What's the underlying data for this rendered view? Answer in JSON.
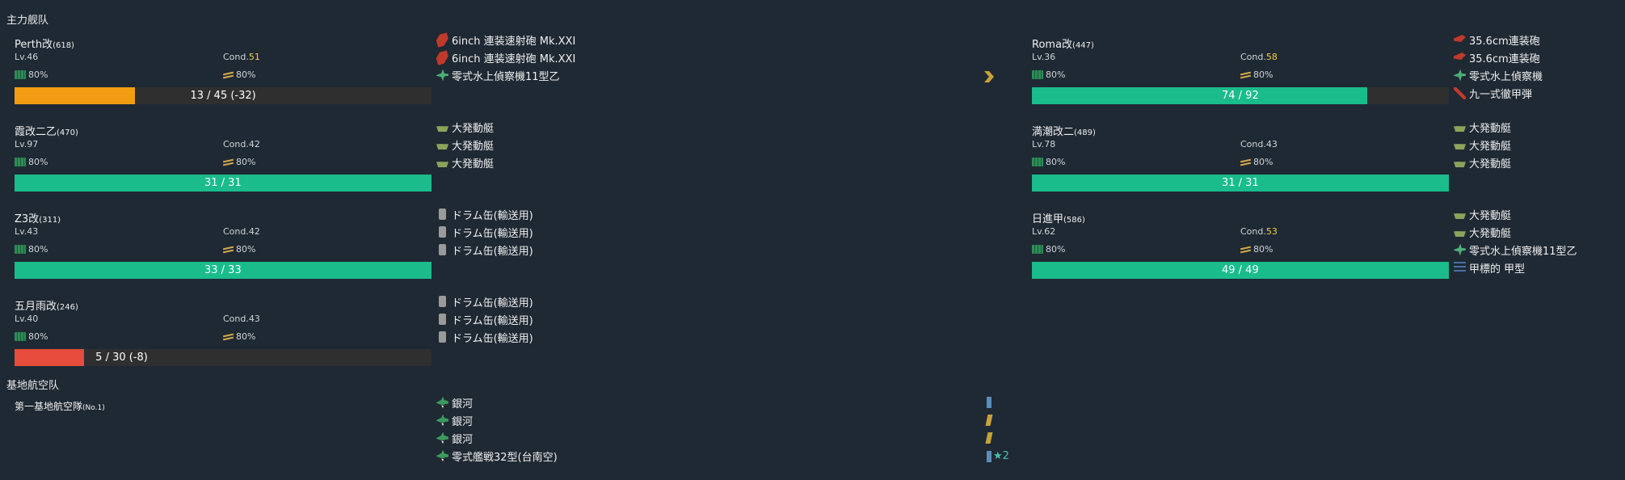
{
  "fleet": {
    "title": "主力舰队",
    "ships": [
      {
        "name": "Perth改",
        "id": "(618)",
        "lv": "Lv.46",
        "cond_label": "Cond.",
        "cond_value": "51",
        "cond_hi": true,
        "fuel": "80%",
        "ammo": "80%",
        "hp_text": "13 / 45 (-32)",
        "hp_frac": 0.289,
        "hp_color": "#f39c12",
        "equip": [
          {
            "icon": "ic-gun",
            "name": "6inch 連装速射砲 Mk.XXI"
          },
          {
            "icon": "ic-gun",
            "name": "6inch 連装速射砲 Mk.XXI"
          },
          {
            "icon": "ic-plane",
            "name": "零式水上偵察機11型乙",
            "prof": "1"
          }
        ]
      },
      {
        "name": "霞改二乙",
        "id": "(470)",
        "lv": "Lv.97",
        "cond_label": "Cond.",
        "cond_value": "42",
        "cond_hi": false,
        "fuel": "80%",
        "ammo": "80%",
        "hp_text": "31 / 31",
        "hp_frac": 1.0,
        "hp_color": "#1abc8c",
        "equip": [
          {
            "icon": "ic-boat",
            "name": "大発動艇"
          },
          {
            "icon": "ic-boat",
            "name": "大発動艇"
          },
          {
            "icon": "ic-boat",
            "name": "大発動艇"
          }
        ]
      },
      {
        "name": "Z3改",
        "id": "(311)",
        "lv": "Lv.43",
        "cond_label": "Cond.",
        "cond_value": "42",
        "cond_hi": false,
        "fuel": "80%",
        "ammo": "80%",
        "hp_text": "33 / 33",
        "hp_frac": 1.0,
        "hp_color": "#1abc8c",
        "equip": [
          {
            "icon": "ic-drum",
            "name": "ドラム缶(輸送用)"
          },
          {
            "icon": "ic-drum",
            "name": "ドラム缶(輸送用)"
          },
          {
            "icon": "ic-drum",
            "name": "ドラム缶(輸送用)"
          }
        ]
      },
      {
        "name": "五月雨改",
        "id": "(246)",
        "lv": "Lv.40",
        "cond_label": "Cond.",
        "cond_value": "43",
        "cond_hi": false,
        "fuel": "80%",
        "ammo": "80%",
        "hp_text": "5 / 30 (-8)",
        "hp_frac": 0.167,
        "hp_color": "#e74c3c",
        "equip": [
          {
            "icon": "ic-drum",
            "name": "ドラム缶(輸送用)"
          },
          {
            "icon": "ic-drum",
            "name": "ドラム缶(輸送用)"
          },
          {
            "icon": "ic-drum",
            "name": "ドラム缶(輸送用)"
          }
        ]
      },
      {
        "name": "Roma改",
        "id": "(447)",
        "lv": "Lv.36",
        "cond_label": "Cond.",
        "cond_value": "58",
        "cond_hi": true,
        "fuel": "80%",
        "ammo": "80%",
        "hp_text": "74 / 92",
        "hp_frac": 0.804,
        "hp_color": "#1abc8c",
        "equip": [
          {
            "icon": "ic-gunl",
            "name": "35.6cm連装砲"
          },
          {
            "icon": "ic-gunl",
            "name": "35.6cm連装砲"
          },
          {
            "icon": "ic-plane",
            "name": "零式水上偵察機",
            "prof": "3"
          },
          {
            "icon": "ic-shell",
            "name": "九一式徹甲弾"
          }
        ]
      },
      {
        "name": "満潮改二",
        "id": "(489)",
        "lv": "Lv.78",
        "cond_label": "Cond.",
        "cond_value": "43",
        "cond_hi": false,
        "fuel": "80%",
        "ammo": "80%",
        "hp_text": "31 / 31",
        "hp_frac": 1.0,
        "hp_color": "#1abc8c",
        "equip": [
          {
            "icon": "ic-boat",
            "name": "大発動艇"
          },
          {
            "icon": "ic-boat",
            "name": "大発動艇"
          },
          {
            "icon": "ic-boat",
            "name": "大発動艇"
          }
        ]
      },
      {
        "name": "日進甲",
        "id": "(586)",
        "lv": "Lv.62",
        "cond_label": "Cond.",
        "cond_value": "53",
        "cond_hi": true,
        "fuel": "80%",
        "ammo": "80%",
        "hp_text": "49 / 49",
        "hp_frac": 1.0,
        "hp_color": "#1abc8c",
        "equip": [
          {
            "icon": "ic-boat",
            "name": "大発動艇"
          },
          {
            "icon": "ic-boat",
            "name": "大発動艇"
          },
          {
            "icon": "ic-plane",
            "name": "零式水上偵察機11型乙",
            "prof": "12"
          },
          {
            "icon": "ic-radar",
            "name": "甲標的 甲型"
          }
        ]
      }
    ]
  },
  "lbas": {
    "title": "基地航空队",
    "squad_name": "第一基地航空隊",
    "squad_no": "(No.1)",
    "planes": [
      {
        "icon": "ic-bomber",
        "name": "銀河",
        "prof": "18",
        "mark_color": "#5b8db8"
      },
      {
        "icon": "ic-bomber",
        "name": "銀河",
        "prof": "18",
        "mark_color": "#c9a23a"
      },
      {
        "icon": "ic-bomber",
        "name": "銀河",
        "prof": "18",
        "mark_color": "#c9a23a"
      },
      {
        "icon": "ic-bomber",
        "name": "零式艦戦32型(台南空)",
        "prof": "18",
        "mark_color": "#5b8db8",
        "star": "★2"
      }
    ]
  },
  "colors": {
    "green": "#1abc8c",
    "orange": "#f39c12",
    "red": "#e74c3c",
    "cond_hi": "#f4d03f"
  }
}
